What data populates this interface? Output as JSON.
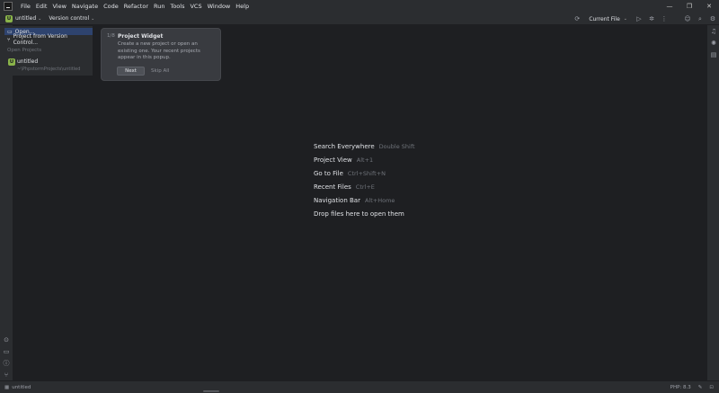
{
  "menubar": {
    "items": [
      "File",
      "Edit",
      "View",
      "Navigate",
      "Code",
      "Refactor",
      "Run",
      "Tools",
      "VCS",
      "Window",
      "Help"
    ],
    "minimize_icon": "minimize-icon",
    "maximize_icon": "maximize-icon",
    "close_icon": "close-icon"
  },
  "toolbar": {
    "project_badge": "U",
    "project_name": "untitled",
    "vcs_label": "Version control",
    "run_config": "Current File"
  },
  "popup": {
    "open_label": "Open...",
    "vcs_project_label": "Project from Version Control...",
    "section_label": "Open Projects",
    "recent_badge": "U",
    "recent_name": "untitled",
    "recent_path": "~\\PhpstormProjects\\untitled"
  },
  "tooltip": {
    "step": "1/8",
    "title": "Project Widget",
    "body": "Create a new project or open an existing one. Your recent projects appear in this popup.",
    "next_label": "Next",
    "skip_label": "Skip All"
  },
  "hints": [
    {
      "label": "Search Everywhere",
      "key": "Double Shift"
    },
    {
      "label": "Project View",
      "key": "Alt+1"
    },
    {
      "label": "Go to File",
      "key": "Ctrl+Shift+N"
    },
    {
      "label": "Recent Files",
      "key": "Ctrl+E"
    },
    {
      "label": "Navigation Bar",
      "key": "Alt+Home"
    },
    {
      "label": "Drop files here to open them",
      "key": ""
    }
  ],
  "statusbar": {
    "project": "untitled",
    "php_version": "PHP: 8.3"
  },
  "colors": {
    "background": "#1e1f22",
    "panel": "#2b2d30",
    "selection": "#2e436e",
    "project_badge": "#8ab44a"
  }
}
